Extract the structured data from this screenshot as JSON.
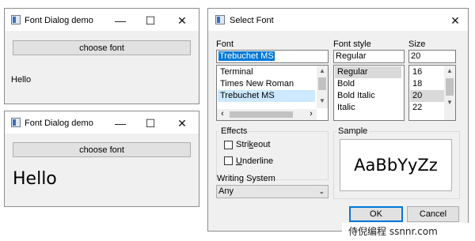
{
  "demo1": {
    "title": "Font Dialog demo",
    "choose_button": "choose font",
    "sample_text": "Hello",
    "controls": {
      "minimize": "—",
      "maximize": "☐",
      "close": "✕"
    }
  },
  "demo2": {
    "title": "Font Dialog demo",
    "choose_button": "choose font",
    "sample_text": "Hello",
    "controls": {
      "minimize": "—",
      "maximize": "☐",
      "close": "✕"
    }
  },
  "dialog": {
    "title": "Select Font",
    "close": "✕",
    "font": {
      "label": "Font",
      "value": "Trebuchet MS",
      "items": [
        "Terminal",
        "Times New Roman",
        "Trebuchet MS"
      ]
    },
    "style": {
      "label": "Font style",
      "value": "Regular",
      "items": [
        "Regular",
        "Bold",
        "Bold Italic",
        "Italic"
      ]
    },
    "size": {
      "label": "Size",
      "value": "20",
      "items": [
        "16",
        "18",
        "20",
        "22"
      ]
    },
    "effects": {
      "label": "Effects",
      "strikeout": {
        "first": "Stri",
        "underlined": "k",
        "rest": "eout"
      },
      "underline": {
        "first": "",
        "underlined": "U",
        "rest": "nderline"
      }
    },
    "writing_system": {
      "label": "Writing System",
      "value": "Any"
    },
    "sample": {
      "label": "Sample",
      "text": "AaBbYyZz"
    },
    "ok": "OK",
    "cancel": "Cancel"
  },
  "watermark": "侍倪编程 ssnnr.com"
}
